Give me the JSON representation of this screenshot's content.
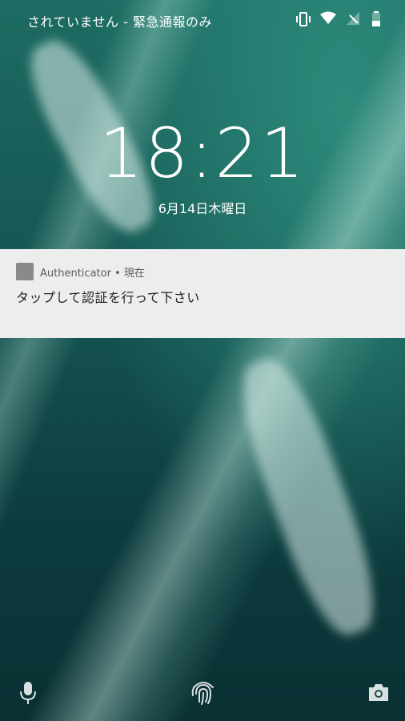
{
  "status_bar": {
    "carrier_text": "されていません - 緊急通報のみ",
    "icons": [
      "vibrate-icon",
      "wifi-icon",
      "no-signal-icon",
      "battery-icon"
    ]
  },
  "lockscreen": {
    "time": "18:21",
    "date": "6月14日木曜日"
  },
  "notification": {
    "app_line": "Authenticator • 現在",
    "message": "タップして認証を行って下さい"
  },
  "bottom_bar": {
    "icons": [
      "microphone-icon",
      "fingerprint-icon",
      "camera-icon"
    ]
  }
}
